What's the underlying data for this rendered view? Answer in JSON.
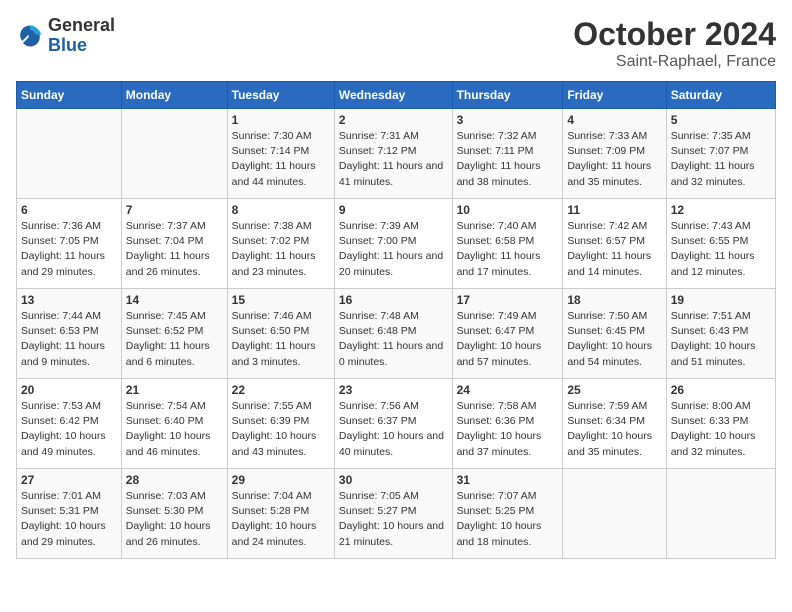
{
  "header": {
    "logo_general": "General",
    "logo_blue": "Blue",
    "title": "October 2024",
    "subtitle": "Saint-Raphael, France"
  },
  "days_of_week": [
    "Sunday",
    "Monday",
    "Tuesday",
    "Wednesday",
    "Thursday",
    "Friday",
    "Saturday"
  ],
  "weeks": [
    [
      {
        "day": "",
        "content": ""
      },
      {
        "day": "",
        "content": ""
      },
      {
        "day": "1",
        "content": "Sunrise: 7:30 AM\nSunset: 7:14 PM\nDaylight: 11 hours and 44 minutes."
      },
      {
        "day": "2",
        "content": "Sunrise: 7:31 AM\nSunset: 7:12 PM\nDaylight: 11 hours and 41 minutes."
      },
      {
        "day": "3",
        "content": "Sunrise: 7:32 AM\nSunset: 7:11 PM\nDaylight: 11 hours and 38 minutes."
      },
      {
        "day": "4",
        "content": "Sunrise: 7:33 AM\nSunset: 7:09 PM\nDaylight: 11 hours and 35 minutes."
      },
      {
        "day": "5",
        "content": "Sunrise: 7:35 AM\nSunset: 7:07 PM\nDaylight: 11 hours and 32 minutes."
      }
    ],
    [
      {
        "day": "6",
        "content": "Sunrise: 7:36 AM\nSunset: 7:05 PM\nDaylight: 11 hours and 29 minutes."
      },
      {
        "day": "7",
        "content": "Sunrise: 7:37 AM\nSunset: 7:04 PM\nDaylight: 11 hours and 26 minutes."
      },
      {
        "day": "8",
        "content": "Sunrise: 7:38 AM\nSunset: 7:02 PM\nDaylight: 11 hours and 23 minutes."
      },
      {
        "day": "9",
        "content": "Sunrise: 7:39 AM\nSunset: 7:00 PM\nDaylight: 11 hours and 20 minutes."
      },
      {
        "day": "10",
        "content": "Sunrise: 7:40 AM\nSunset: 6:58 PM\nDaylight: 11 hours and 17 minutes."
      },
      {
        "day": "11",
        "content": "Sunrise: 7:42 AM\nSunset: 6:57 PM\nDaylight: 11 hours and 14 minutes."
      },
      {
        "day": "12",
        "content": "Sunrise: 7:43 AM\nSunset: 6:55 PM\nDaylight: 11 hours and 12 minutes."
      }
    ],
    [
      {
        "day": "13",
        "content": "Sunrise: 7:44 AM\nSunset: 6:53 PM\nDaylight: 11 hours and 9 minutes."
      },
      {
        "day": "14",
        "content": "Sunrise: 7:45 AM\nSunset: 6:52 PM\nDaylight: 11 hours and 6 minutes."
      },
      {
        "day": "15",
        "content": "Sunrise: 7:46 AM\nSunset: 6:50 PM\nDaylight: 11 hours and 3 minutes."
      },
      {
        "day": "16",
        "content": "Sunrise: 7:48 AM\nSunset: 6:48 PM\nDaylight: 11 hours and 0 minutes."
      },
      {
        "day": "17",
        "content": "Sunrise: 7:49 AM\nSunset: 6:47 PM\nDaylight: 10 hours and 57 minutes."
      },
      {
        "day": "18",
        "content": "Sunrise: 7:50 AM\nSunset: 6:45 PM\nDaylight: 10 hours and 54 minutes."
      },
      {
        "day": "19",
        "content": "Sunrise: 7:51 AM\nSunset: 6:43 PM\nDaylight: 10 hours and 51 minutes."
      }
    ],
    [
      {
        "day": "20",
        "content": "Sunrise: 7:53 AM\nSunset: 6:42 PM\nDaylight: 10 hours and 49 minutes."
      },
      {
        "day": "21",
        "content": "Sunrise: 7:54 AM\nSunset: 6:40 PM\nDaylight: 10 hours and 46 minutes."
      },
      {
        "day": "22",
        "content": "Sunrise: 7:55 AM\nSunset: 6:39 PM\nDaylight: 10 hours and 43 minutes."
      },
      {
        "day": "23",
        "content": "Sunrise: 7:56 AM\nSunset: 6:37 PM\nDaylight: 10 hours and 40 minutes."
      },
      {
        "day": "24",
        "content": "Sunrise: 7:58 AM\nSunset: 6:36 PM\nDaylight: 10 hours and 37 minutes."
      },
      {
        "day": "25",
        "content": "Sunrise: 7:59 AM\nSunset: 6:34 PM\nDaylight: 10 hours and 35 minutes."
      },
      {
        "day": "26",
        "content": "Sunrise: 8:00 AM\nSunset: 6:33 PM\nDaylight: 10 hours and 32 minutes."
      }
    ],
    [
      {
        "day": "27",
        "content": "Sunrise: 7:01 AM\nSunset: 5:31 PM\nDaylight: 10 hours and 29 minutes."
      },
      {
        "day": "28",
        "content": "Sunrise: 7:03 AM\nSunset: 5:30 PM\nDaylight: 10 hours and 26 minutes."
      },
      {
        "day": "29",
        "content": "Sunrise: 7:04 AM\nSunset: 5:28 PM\nDaylight: 10 hours and 24 minutes."
      },
      {
        "day": "30",
        "content": "Sunrise: 7:05 AM\nSunset: 5:27 PM\nDaylight: 10 hours and 21 minutes."
      },
      {
        "day": "31",
        "content": "Sunrise: 7:07 AM\nSunset: 5:25 PM\nDaylight: 10 hours and 18 minutes."
      },
      {
        "day": "",
        "content": ""
      },
      {
        "day": "",
        "content": ""
      }
    ]
  ]
}
